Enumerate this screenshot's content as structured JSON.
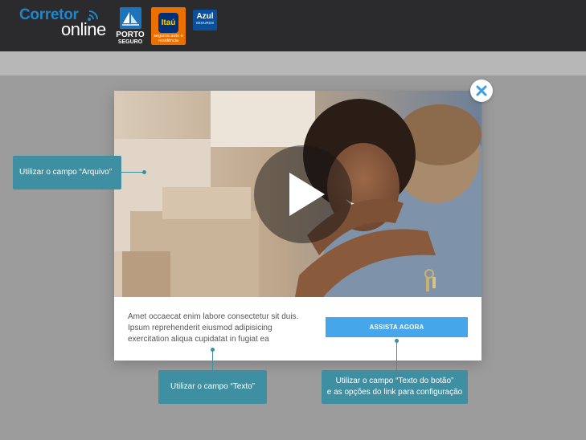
{
  "header": {
    "brand_line1": "Corretor",
    "brand_line2": "online",
    "partners": [
      {
        "name": "PORTO",
        "sub": "SEGURO"
      },
      {
        "name": "Itaú",
        "sub": "seguros auto e residência"
      },
      {
        "name": "Azul",
        "sub": "SEGUROS"
      }
    ]
  },
  "modal": {
    "text": "Amet occaecat enim labore consectetur sit duis. Ipsum reprehenderit eiusmod adipisicing exercitation aliqua cupidatat in fugiat ea",
    "button_label": "ASSISTA AGORA"
  },
  "annotations": {
    "file": "Utilizar o campo “Arquivo”",
    "text": "Utilizar o campo “Texto”",
    "button_line1": "Utilizar o campo “Texto do botão”",
    "button_line2": "e as opções do link para configuração"
  },
  "colors": {
    "header_bg": "#2b2b2d",
    "overlay": "#9c9c9c",
    "accent": "#46a6ea",
    "callout": "#3d8fa1"
  }
}
